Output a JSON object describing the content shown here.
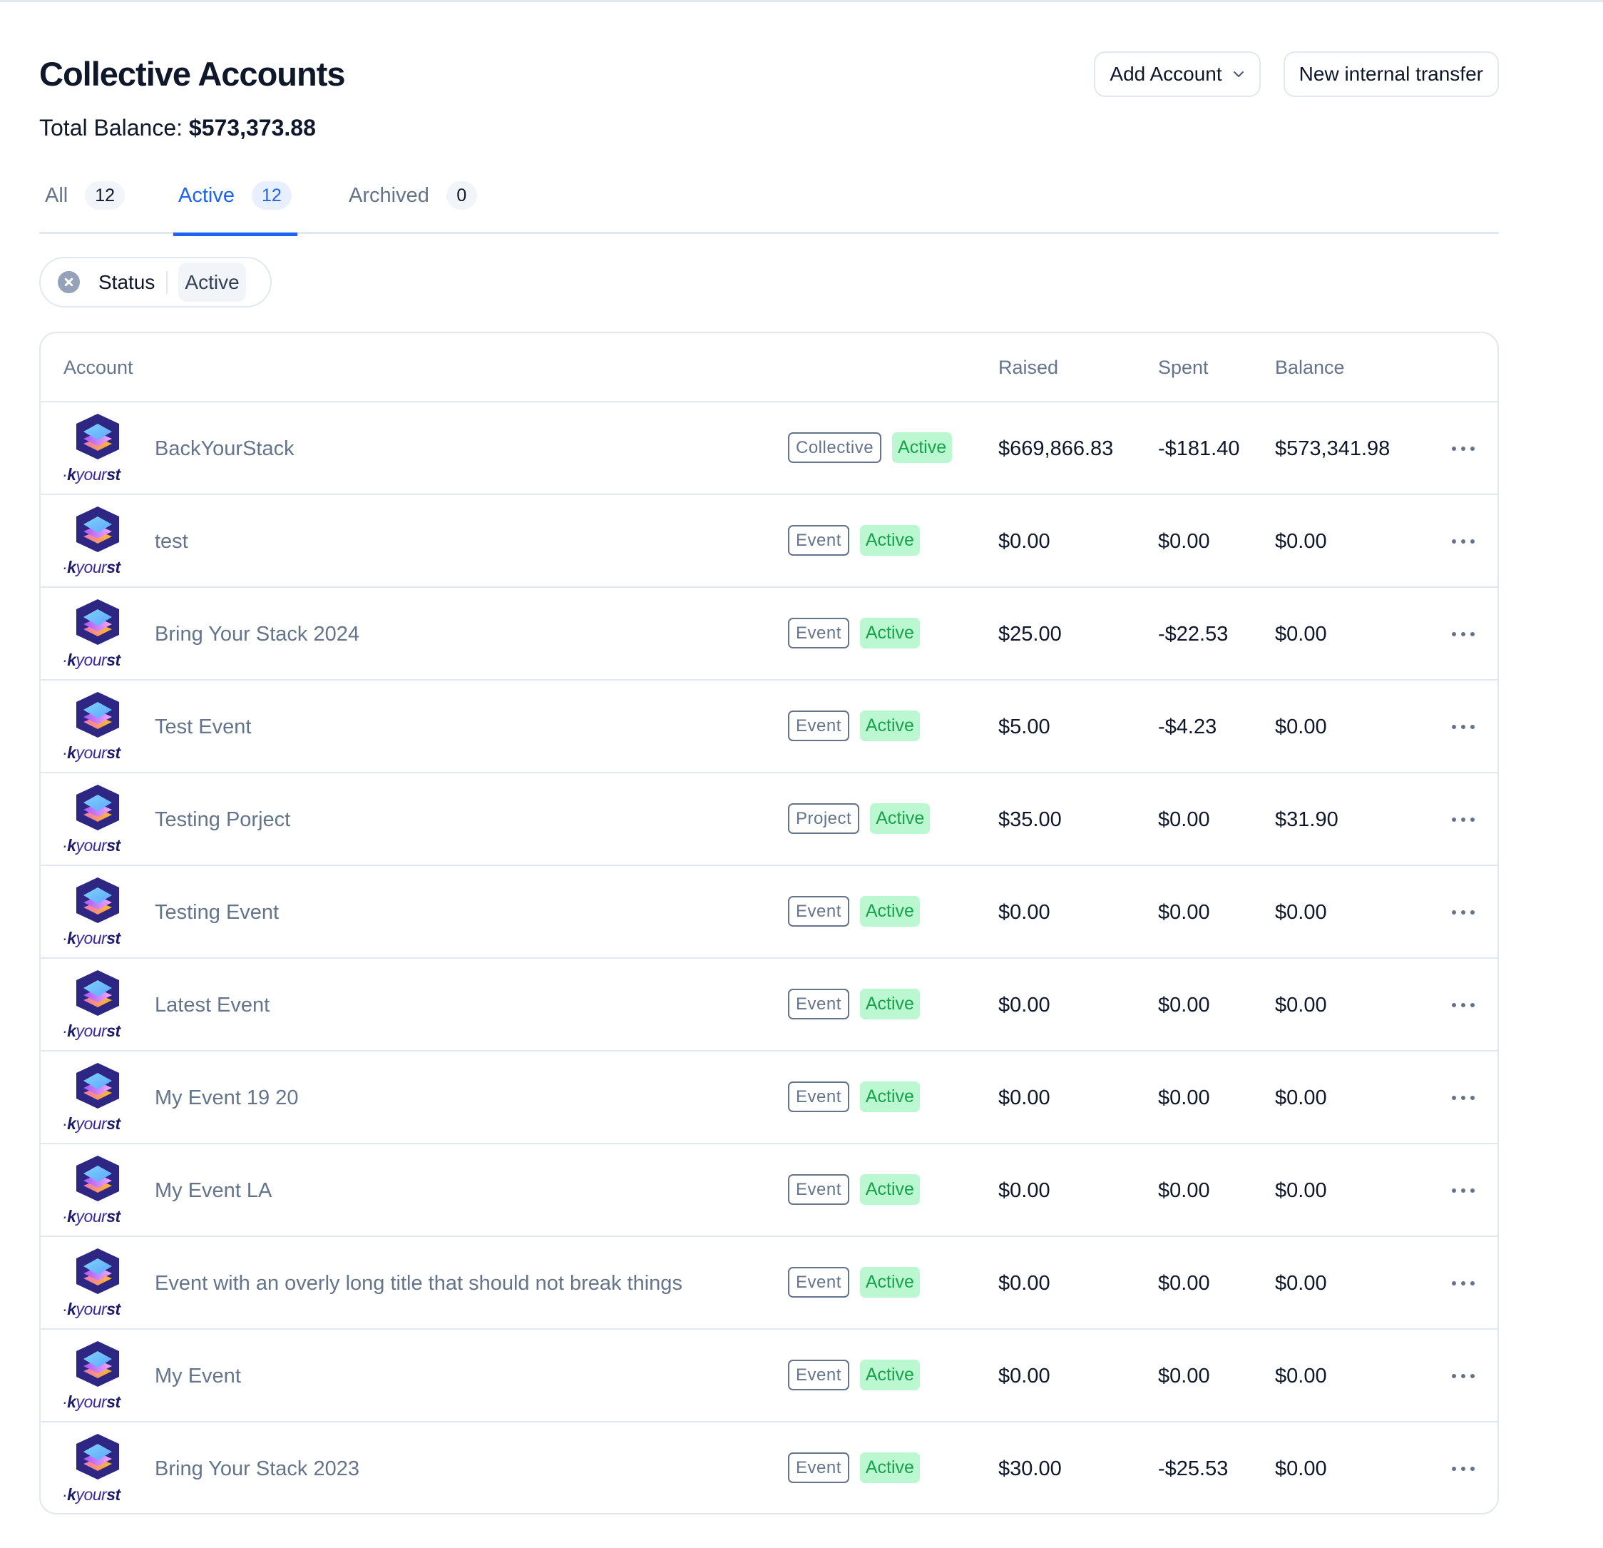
{
  "page": {
    "title": "Collective Accounts",
    "total_balance_label": "Total Balance:",
    "total_balance_value": "$573,373.88"
  },
  "actions": {
    "add_account_label": "Add Account",
    "add_account_icon": "chevron-down-icon",
    "new_transfer_label": "New internal transfer"
  },
  "tabs": [
    {
      "label": "All",
      "count": "12",
      "active": false
    },
    {
      "label": "Active",
      "count": "12",
      "active": true
    },
    {
      "label": "Archived",
      "count": "0",
      "active": false
    }
  ],
  "filter": {
    "remove_icon": "x-circle-icon",
    "label": "Status",
    "value": "Active"
  },
  "table": {
    "columns": [
      "Account",
      "Raised",
      "Spent",
      "Balance"
    ],
    "avatar_text_prefix": "k",
    "avatar_text_middle": "your",
    "avatar_text_suffix": "st",
    "row_menu_icon": "more-horizontal-icon",
    "rows": [
      {
        "name": "BackYourStack",
        "type": "Collective",
        "status": "Active",
        "raised": "$669,866.83",
        "spent": "-$181.40",
        "balance": "$573,341.98"
      },
      {
        "name": "test",
        "type": "Event",
        "status": "Active",
        "raised": "$0.00",
        "spent": "$0.00",
        "balance": "$0.00"
      },
      {
        "name": "Bring Your Stack 2024",
        "type": "Event",
        "status": "Active",
        "raised": "$25.00",
        "spent": "-$22.53",
        "balance": "$0.00"
      },
      {
        "name": "Test Event",
        "type": "Event",
        "status": "Active",
        "raised": "$5.00",
        "spent": "-$4.23",
        "balance": "$0.00"
      },
      {
        "name": "Testing Porject",
        "type": "Project",
        "status": "Active",
        "raised": "$35.00",
        "spent": "$0.00",
        "balance": "$31.90"
      },
      {
        "name": "Testing Event",
        "type": "Event",
        "status": "Active",
        "raised": "$0.00",
        "spent": "$0.00",
        "balance": "$0.00"
      },
      {
        "name": "Latest Event",
        "type": "Event",
        "status": "Active",
        "raised": "$0.00",
        "spent": "$0.00",
        "balance": "$0.00"
      },
      {
        "name": "My Event 19 20",
        "type": "Event",
        "status": "Active",
        "raised": "$0.00",
        "spent": "$0.00",
        "balance": "$0.00"
      },
      {
        "name": "My Event LA",
        "type": "Event",
        "status": "Active",
        "raised": "$0.00",
        "spent": "$0.00",
        "balance": "$0.00"
      },
      {
        "name": "Event with an overly long title that should not break things",
        "type": "Event",
        "status": "Active",
        "raised": "$0.00",
        "spent": "$0.00",
        "balance": "$0.00"
      },
      {
        "name": "My Event",
        "type": "Event",
        "status": "Active",
        "raised": "$0.00",
        "spent": "$0.00",
        "balance": "$0.00"
      },
      {
        "name": "Bring Your Stack 2023",
        "type": "Event",
        "status": "Active",
        "raised": "$30.00",
        "spent": "-$25.53",
        "balance": "$0.00"
      }
    ]
  },
  "colors": {
    "accent": "#1d64f2",
    "status_active_bg": "#bbf7d0",
    "status_active_text": "#16a34a",
    "muted_text": "#64748b",
    "border": "#e2e8f0"
  }
}
